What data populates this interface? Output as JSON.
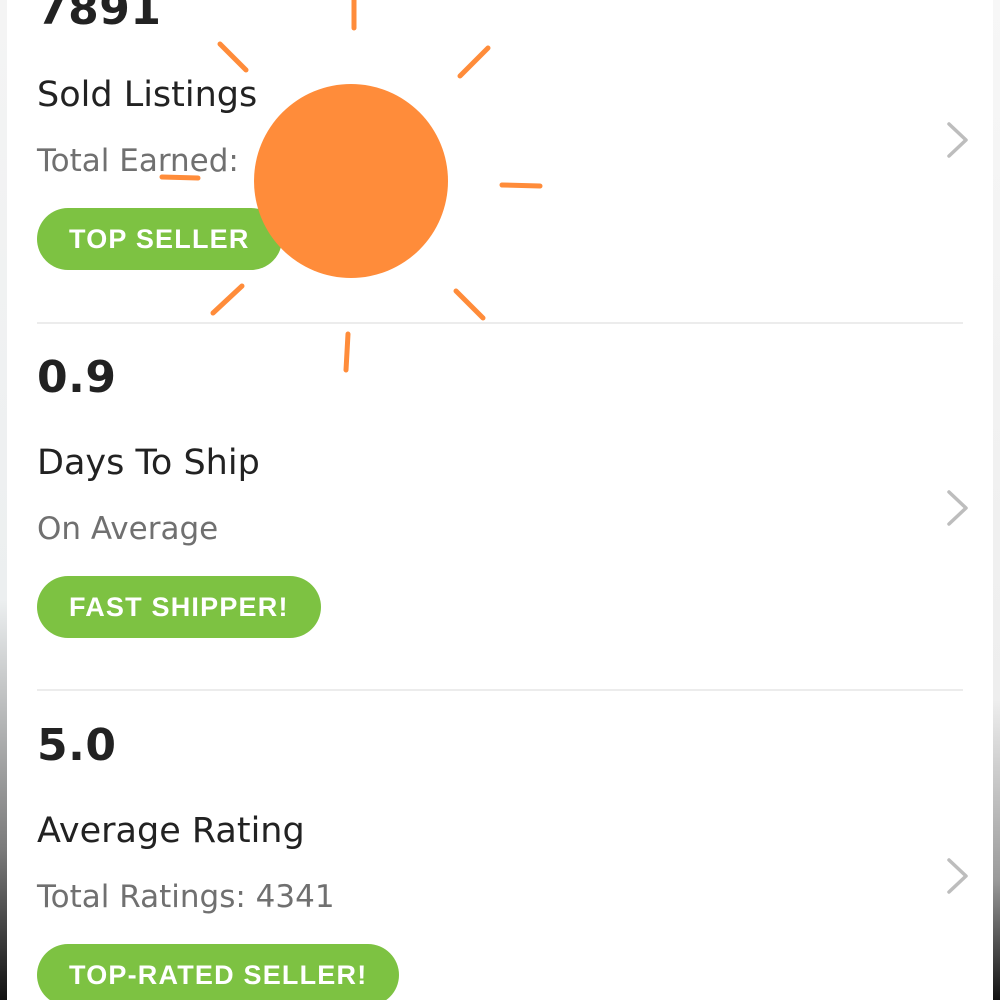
{
  "stats": [
    {
      "value": "7891",
      "title": "Sold Listings",
      "subtitle": "Total Earned:",
      "badge": "TOP SELLER",
      "chevron_icon": "chevron-right-icon"
    },
    {
      "value": "0.9",
      "title": "Days To Ship",
      "subtitle": "On Average",
      "badge": "FAST SHIPPER!",
      "chevron_icon": "chevron-right-icon"
    },
    {
      "value": "5.0",
      "title": "Average Rating",
      "subtitle": "Total Ratings: 4341",
      "badge": "TOP-RATED SELLER!",
      "chevron_icon": "chevron-right-icon"
    }
  ],
  "overlay": {
    "icon": "sun-icon",
    "color": "#ff8c3a"
  },
  "colors": {
    "badge_green": "#7dc242",
    "text_dark": "#222222",
    "text_muted": "#707070",
    "chevron": "#bdbdbd",
    "divider": "#ececec"
  }
}
